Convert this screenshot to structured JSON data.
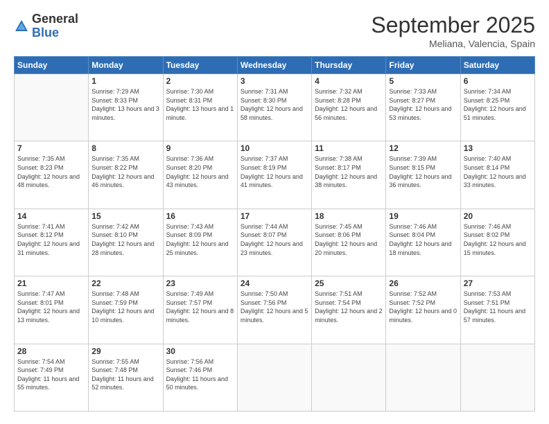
{
  "logo": {
    "general": "General",
    "blue": "Blue"
  },
  "title": "September 2025",
  "location": "Meliana, Valencia, Spain",
  "weekdays": [
    "Sunday",
    "Monday",
    "Tuesday",
    "Wednesday",
    "Thursday",
    "Friday",
    "Saturday"
  ],
  "weeks": [
    [
      {
        "day": "",
        "sunrise": "",
        "sunset": "",
        "daylight": ""
      },
      {
        "day": "1",
        "sunrise": "Sunrise: 7:29 AM",
        "sunset": "Sunset: 8:33 PM",
        "daylight": "Daylight: 13 hours and 3 minutes."
      },
      {
        "day": "2",
        "sunrise": "Sunrise: 7:30 AM",
        "sunset": "Sunset: 8:31 PM",
        "daylight": "Daylight: 13 hours and 1 minute."
      },
      {
        "day": "3",
        "sunrise": "Sunrise: 7:31 AM",
        "sunset": "Sunset: 8:30 PM",
        "daylight": "Daylight: 12 hours and 58 minutes."
      },
      {
        "day": "4",
        "sunrise": "Sunrise: 7:32 AM",
        "sunset": "Sunset: 8:28 PM",
        "daylight": "Daylight: 12 hours and 56 minutes."
      },
      {
        "day": "5",
        "sunrise": "Sunrise: 7:33 AM",
        "sunset": "Sunset: 8:27 PM",
        "daylight": "Daylight: 12 hours and 53 minutes."
      },
      {
        "day": "6",
        "sunrise": "Sunrise: 7:34 AM",
        "sunset": "Sunset: 8:25 PM",
        "daylight": "Daylight: 12 hours and 51 minutes."
      }
    ],
    [
      {
        "day": "7",
        "sunrise": "Sunrise: 7:35 AM",
        "sunset": "Sunset: 8:23 PM",
        "daylight": "Daylight: 12 hours and 48 minutes."
      },
      {
        "day": "8",
        "sunrise": "Sunrise: 7:35 AM",
        "sunset": "Sunset: 8:22 PM",
        "daylight": "Daylight: 12 hours and 46 minutes."
      },
      {
        "day": "9",
        "sunrise": "Sunrise: 7:36 AM",
        "sunset": "Sunset: 8:20 PM",
        "daylight": "Daylight: 12 hours and 43 minutes."
      },
      {
        "day": "10",
        "sunrise": "Sunrise: 7:37 AM",
        "sunset": "Sunset: 8:19 PM",
        "daylight": "Daylight: 12 hours and 41 minutes."
      },
      {
        "day": "11",
        "sunrise": "Sunrise: 7:38 AM",
        "sunset": "Sunset: 8:17 PM",
        "daylight": "Daylight: 12 hours and 38 minutes."
      },
      {
        "day": "12",
        "sunrise": "Sunrise: 7:39 AM",
        "sunset": "Sunset: 8:15 PM",
        "daylight": "Daylight: 12 hours and 36 minutes."
      },
      {
        "day": "13",
        "sunrise": "Sunrise: 7:40 AM",
        "sunset": "Sunset: 8:14 PM",
        "daylight": "Daylight: 12 hours and 33 minutes."
      }
    ],
    [
      {
        "day": "14",
        "sunrise": "Sunrise: 7:41 AM",
        "sunset": "Sunset: 8:12 PM",
        "daylight": "Daylight: 12 hours and 31 minutes."
      },
      {
        "day": "15",
        "sunrise": "Sunrise: 7:42 AM",
        "sunset": "Sunset: 8:10 PM",
        "daylight": "Daylight: 12 hours and 28 minutes."
      },
      {
        "day": "16",
        "sunrise": "Sunrise: 7:43 AM",
        "sunset": "Sunset: 8:09 PM",
        "daylight": "Daylight: 12 hours and 25 minutes."
      },
      {
        "day": "17",
        "sunrise": "Sunrise: 7:44 AM",
        "sunset": "Sunset: 8:07 PM",
        "daylight": "Daylight: 12 hours and 23 minutes."
      },
      {
        "day": "18",
        "sunrise": "Sunrise: 7:45 AM",
        "sunset": "Sunset: 8:06 PM",
        "daylight": "Daylight: 12 hours and 20 minutes."
      },
      {
        "day": "19",
        "sunrise": "Sunrise: 7:46 AM",
        "sunset": "Sunset: 8:04 PM",
        "daylight": "Daylight: 12 hours and 18 minutes."
      },
      {
        "day": "20",
        "sunrise": "Sunrise: 7:46 AM",
        "sunset": "Sunset: 8:02 PM",
        "daylight": "Daylight: 12 hours and 15 minutes."
      }
    ],
    [
      {
        "day": "21",
        "sunrise": "Sunrise: 7:47 AM",
        "sunset": "Sunset: 8:01 PM",
        "daylight": "Daylight: 12 hours and 13 minutes."
      },
      {
        "day": "22",
        "sunrise": "Sunrise: 7:48 AM",
        "sunset": "Sunset: 7:59 PM",
        "daylight": "Daylight: 12 hours and 10 minutes."
      },
      {
        "day": "23",
        "sunrise": "Sunrise: 7:49 AM",
        "sunset": "Sunset: 7:57 PM",
        "daylight": "Daylight: 12 hours and 8 minutes."
      },
      {
        "day": "24",
        "sunrise": "Sunrise: 7:50 AM",
        "sunset": "Sunset: 7:56 PM",
        "daylight": "Daylight: 12 hours and 5 minutes."
      },
      {
        "day": "25",
        "sunrise": "Sunrise: 7:51 AM",
        "sunset": "Sunset: 7:54 PM",
        "daylight": "Daylight: 12 hours and 2 minutes."
      },
      {
        "day": "26",
        "sunrise": "Sunrise: 7:52 AM",
        "sunset": "Sunset: 7:52 PM",
        "daylight": "Daylight: 12 hours and 0 minutes."
      },
      {
        "day": "27",
        "sunrise": "Sunrise: 7:53 AM",
        "sunset": "Sunset: 7:51 PM",
        "daylight": "Daylight: 11 hours and 57 minutes."
      }
    ],
    [
      {
        "day": "28",
        "sunrise": "Sunrise: 7:54 AM",
        "sunset": "Sunset: 7:49 PM",
        "daylight": "Daylight: 11 hours and 55 minutes."
      },
      {
        "day": "29",
        "sunrise": "Sunrise: 7:55 AM",
        "sunset": "Sunset: 7:48 PM",
        "daylight": "Daylight: 11 hours and 52 minutes."
      },
      {
        "day": "30",
        "sunrise": "Sunrise: 7:56 AM",
        "sunset": "Sunset: 7:46 PM",
        "daylight": "Daylight: 11 hours and 50 minutes."
      },
      {
        "day": "",
        "sunrise": "",
        "sunset": "",
        "daylight": ""
      },
      {
        "day": "",
        "sunrise": "",
        "sunset": "",
        "daylight": ""
      },
      {
        "day": "",
        "sunrise": "",
        "sunset": "",
        "daylight": ""
      },
      {
        "day": "",
        "sunrise": "",
        "sunset": "",
        "daylight": ""
      }
    ]
  ]
}
